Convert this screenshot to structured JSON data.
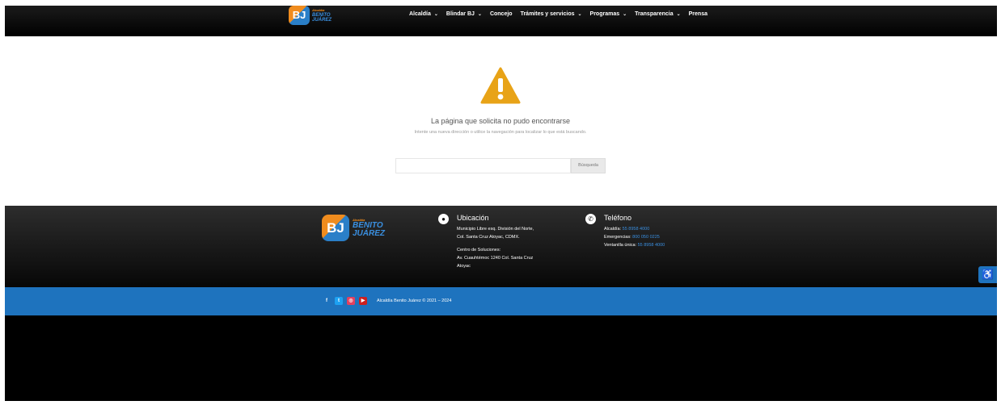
{
  "header": {
    "logo": {
      "initials": "BJ",
      "small": "Alcaldía",
      "line1": "BENITO",
      "line2": "JUÁREZ"
    },
    "nav": [
      {
        "label": "Alcaldía",
        "has_dropdown": true
      },
      {
        "label": "Blindar BJ",
        "has_dropdown": true
      },
      {
        "label": "Concejo",
        "has_dropdown": false
      },
      {
        "label": "Trámites y servicios",
        "has_dropdown": true
      },
      {
        "label": "Programas",
        "has_dropdown": true
      },
      {
        "label": "Transparencia",
        "has_dropdown": true
      },
      {
        "label": "Prensa",
        "has_dropdown": false
      }
    ]
  },
  "error": {
    "title": "La página que solicita no pudo encontrarse",
    "subtitle": "Intente una nueva dirección o utilice la navegación para localizar lo que está buscando.",
    "search_placeholder": "",
    "search_button": "Búsqueda",
    "icon": "warning-icon",
    "icon_color": "#e8a317"
  },
  "footer": {
    "logo": {
      "initials": "BJ",
      "small": "Alcaldía",
      "line1": "BENITO",
      "line2": "JUÁREZ"
    },
    "location": {
      "heading": "Ubicación",
      "line1": "Municipio Libre esq. División del Norte,",
      "line2": "Col. Santa Cruz Atoyac, CDMX.",
      "line3": "Centro de Soluciones:",
      "line4": "Av. Cuauhtémoc 1240 Col. Santa Cruz",
      "line5": "Atoyac"
    },
    "phone": {
      "heading": "Teléfono",
      "rows": [
        {
          "label": "Alcaldía:",
          "value": "55 8958 4000"
        },
        {
          "label": "Emergencias:",
          "value": "800 050 0225"
        },
        {
          "label": "Ventanilla única:",
          "value": "55 8958 4000"
        }
      ]
    }
  },
  "bottom": {
    "copyright": "Alcaldía Benito Juárez © 2021 – 2024",
    "social": [
      "facebook-icon",
      "twitter-icon",
      "instagram-icon",
      "youtube-icon"
    ]
  },
  "colors": {
    "brand_blue": "#1e73be",
    "brand_orange": "#f08c1e",
    "link_blue": "#3a8fe0"
  }
}
